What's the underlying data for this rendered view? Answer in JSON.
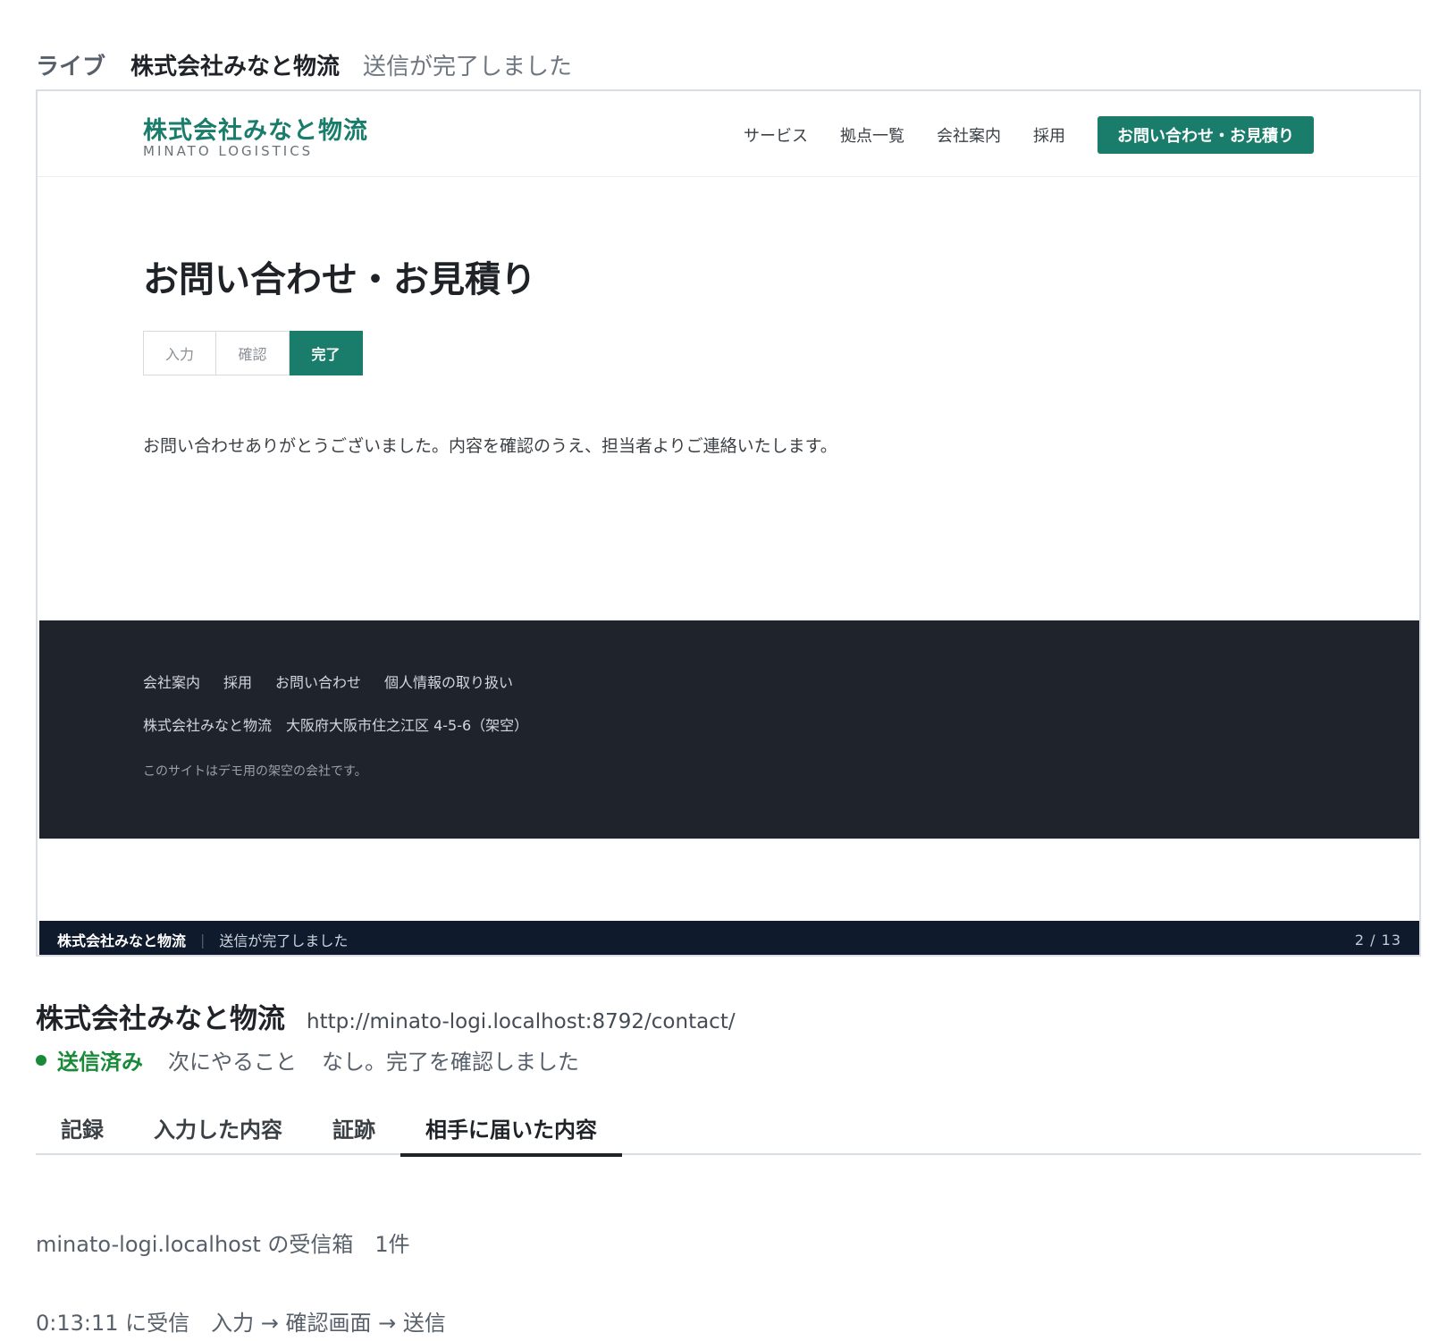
{
  "live_bar": {
    "label": "ライブ",
    "site": "株式会社みなと物流",
    "status": "送信が完了しました"
  },
  "preview": {
    "logo_main": "株式会社みなと物流",
    "logo_sub": "MINATO LOGISTICS",
    "nav": [
      "サービス",
      "拠点一覧",
      "会社案内",
      "採用"
    ],
    "nav_cta": "お問い合わせ・お見積り",
    "heading": "お問い合わせ・お見積り",
    "steps": [
      "入力",
      "確認",
      "完了"
    ],
    "active_step": 2,
    "thanks": "お問い合わせありがとうございました。内容を確認のうえ、担当者よりご連絡いたします。",
    "footer_links": [
      "会社案内",
      "採用",
      "お問い合わせ",
      "個人情報の取り扱い"
    ],
    "footer_address": "株式会社みなと物流　大阪府大阪市住之江区 4-5-6（架空）",
    "footer_note": "このサイトはデモ用の架空の会社です。",
    "caption_site": "株式会社みなと物流",
    "caption_status": "送信が完了しました",
    "caption_page": "2 / 13"
  },
  "details": {
    "company": "株式会社みなと物流",
    "url": "http://minato-logi.localhost:8792/contact/",
    "state": "送信済み",
    "next_label": "次にやること",
    "next_value": "なし。完了を確認しました"
  },
  "tabs": [
    "記録",
    "入力した内容",
    "証跡",
    "相手に届いた内容"
  ],
  "active_tab": 3,
  "inbox": "minato-logi.localhost の受信箱　1件",
  "received": "0:13:11 に受信　入力 → 確認画面 → 送信",
  "colors": {
    "brand_green": "#1a7d6b",
    "footer_bg": "#1f232b",
    "caption_bg": "#0f1a2c",
    "sent_green": "#1a8a3a"
  }
}
